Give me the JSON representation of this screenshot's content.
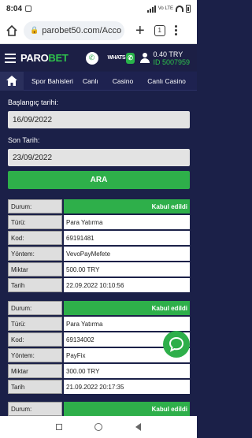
{
  "status_bar": {
    "time": "8:04",
    "network": "Vo LTE"
  },
  "browser": {
    "url": "parobet50.com/Acco",
    "tab_count": "1"
  },
  "site": {
    "logo_prefix": "PARO",
    "logo_suffix": "BET",
    "whatsapp_label": "WHATS",
    "balance": "0.40 TRY",
    "user_id": "ID 5007959"
  },
  "nav": {
    "tabs": [
      "Spor Bahisleri",
      "Canlı",
      "Casino",
      "Canlı Casino"
    ]
  },
  "form": {
    "start_label": "Başlangıç tarihi:",
    "start_value": "16/09/2022",
    "end_label": "Son Tarih:",
    "end_value": "23/09/2022",
    "search_button": "ARA"
  },
  "transactions": [
    {
      "rows": [
        {
          "key": "Durum:",
          "value": "Kabul edildi"
        },
        {
          "key": "Türü:",
          "value": "Para Yatırma"
        },
        {
          "key": "Kod:",
          "value": "69191481"
        },
        {
          "key": "Yöntem:",
          "value": "VevoPayMefete"
        },
        {
          "key": "Miktar",
          "value": "500.00 TRY"
        },
        {
          "key": "Tarih",
          "value": "22.09.2022 10:10:56"
        }
      ]
    },
    {
      "rows": [
        {
          "key": "Durum:",
          "value": "Kabul edildi"
        },
        {
          "key": "Türü:",
          "value": "Para Yatırma"
        },
        {
          "key": "Kod:",
          "value": "69134002"
        },
        {
          "key": "Yöntem:",
          "value": "PayFix"
        },
        {
          "key": "Miktar",
          "value": "300.00 TRY"
        },
        {
          "key": "Tarih",
          "value": "21.09.2022 20:17:35"
        }
      ]
    },
    {
      "rows": [
        {
          "key": "Durum:",
          "value": "Kabul edildi"
        }
      ]
    }
  ],
  "colors": {
    "page_bg": "#1b2048",
    "header_bg": "#1c1f45",
    "accent_green": "#2eaf4a",
    "input_bg": "#e3e3e3"
  },
  "icons": [
    "home-icon",
    "lock-icon",
    "plus-icon",
    "tabs-icon",
    "more-icon",
    "menu-icon",
    "phone-icon",
    "whatsapp-icon",
    "user-icon",
    "chat-icon"
  ]
}
